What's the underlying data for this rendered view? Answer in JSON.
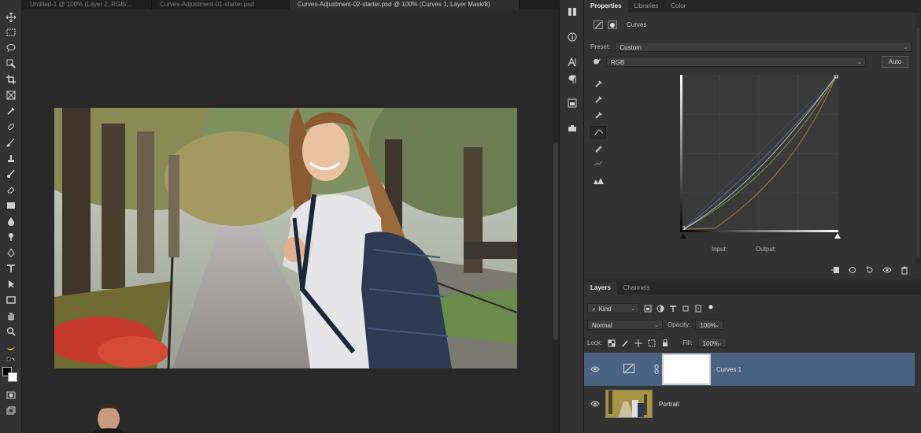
{
  "doc_tabs": [
    {
      "label": "Untitled-1 @ 100% (Layer 2, RGB/...",
      "active": false
    },
    {
      "label": "Curves-Adjustment-01-starter.psd",
      "active": false
    },
    {
      "label": "Curves-Adjustment-02-starter.psd @ 100% (Curves 1, Layer Mask/8)",
      "active": true
    }
  ],
  "properties": {
    "tabs": [
      "Properties",
      "Libraries",
      "Color"
    ],
    "title": "Curves",
    "preset_label": "Preset:",
    "preset_value": "Custom",
    "channel_value": "RGB",
    "auto_label": "Auto",
    "input_label": "Input:",
    "output_label": "Output:"
  },
  "layers": {
    "tabs": [
      "Layers",
      "Channels"
    ],
    "filter_value": "Kind",
    "blend_mode": "Normal",
    "opacity_label": "Opacity:",
    "opacity_value": "100%",
    "lock_label": "Lock:",
    "fill_label": "Fill:",
    "fill_value": "100%",
    "items": [
      {
        "name": "Curves 1",
        "selected": true
      },
      {
        "name": "Portrait",
        "selected": false
      }
    ]
  },
  "colors": {
    "selection_blue": "#4b6383",
    "panel_bg": "#323232",
    "canvas_bg": "#282828"
  }
}
